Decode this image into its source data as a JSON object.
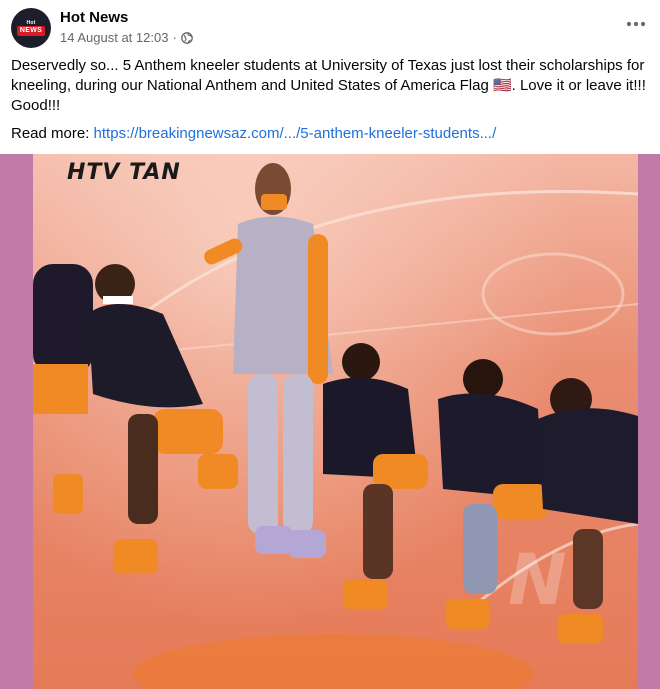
{
  "page": {
    "name": "Hot News",
    "date": "14 August at 12:03",
    "avatar_text_top": "Hot",
    "avatar_text_main": "NEWS"
  },
  "post": {
    "text": "Deservedly so... 5 Anthem kneeler students at University of Texas just lost their scholarships for kneeling, during our National Anthem and United States of America Flag 🇺🇸. Love it or leave it!!! Good!!!",
    "read_more_label": "Read more:",
    "link_text": "https://breakingnewsaz.com/.../5-anthem-kneeler-students.../"
  },
  "image": {
    "watermark": "HTV TAN"
  },
  "icons": {
    "privacy": "globe-icon",
    "menu": "more-horizontal-icon"
  },
  "colors": {
    "link": "#216fdb",
    "secondary_text": "#65676b",
    "image_border": "#c07ba8",
    "jersey_orange": "#f08a24"
  }
}
